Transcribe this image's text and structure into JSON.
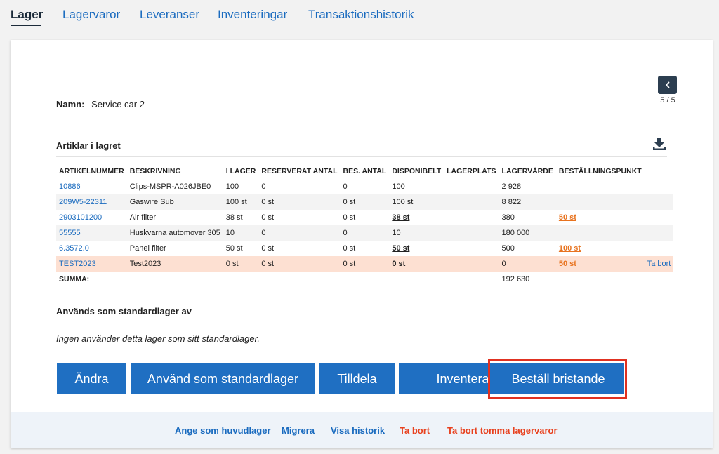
{
  "tabs": [
    "Lager",
    "Lagervaror",
    "Leveranser",
    "Inventeringar",
    "Transaktionshistorik"
  ],
  "name": {
    "label": "Namn:",
    "value": "Service car 2"
  },
  "pager": {
    "text": "5 / 5",
    "icon": "chevron-left-icon"
  },
  "articles": {
    "title": "Artiklar i lagret",
    "download_icon": "download-icon",
    "columns": [
      "Artikelnummer",
      "Beskrivning",
      "I lager",
      "Reserverat antal",
      "Bes. antal",
      "Disponibelt",
      "Lagerplats",
      "Lagervärde",
      "Beställningspunkt",
      ""
    ],
    "rows": [
      {
        "nr": "10886",
        "desc": "Clips-MSPR-A026JBE0",
        "stock": "100",
        "reserved": "0",
        "ordered": "0",
        "available": "100",
        "location": "",
        "value": "2 928",
        "reorder": "",
        "action": ""
      },
      {
        "nr": "209W5-22311",
        "desc": "Gaswire Sub",
        "stock": "100 st",
        "reserved": "0 st",
        "ordered": "0 st",
        "available": "100 st",
        "location": "",
        "value": "8 822",
        "reorder": "",
        "action": ""
      },
      {
        "nr": "2903101200",
        "desc": "Air filter",
        "stock": "38 st",
        "reserved": "0 st",
        "ordered": "0 st",
        "available": "38 st",
        "location": "",
        "value": "380",
        "reorder": "50 st",
        "action": ""
      },
      {
        "nr": "55555",
        "desc": "Huskvarna automover 305",
        "stock": "10",
        "reserved": "0",
        "ordered": "0",
        "available": "10",
        "location": "",
        "value": "180 000",
        "reorder": "",
        "action": ""
      },
      {
        "nr": "6.3572.0",
        "desc": "Panel filter",
        "stock": "50 st",
        "reserved": "0 st",
        "ordered": "0 st",
        "available": "50 st",
        "location": "",
        "value": "500",
        "reorder": "100 st",
        "action": ""
      },
      {
        "nr": "TEST2023",
        "desc": "Test2023",
        "stock": "0 st",
        "reserved": "0 st",
        "ordered": "0 st",
        "available": "0 st",
        "location": "",
        "value": "0",
        "reorder": "50 st",
        "action": "Ta bort"
      }
    ],
    "sum_label": "SUMMA:",
    "sum_value": "192 630"
  },
  "default_usage": {
    "title": "Används som standardlager av",
    "empty_text": "Ingen använder detta lager som sitt standardlager."
  },
  "buttons": [
    "Ändra",
    "Använd som standardlager",
    "Tilldela",
    "Inventera",
    "Beställ bristande"
  ],
  "footer_links": [
    "Ange som huvudlager",
    "Migrera",
    "Visa historik",
    "Ta bort",
    "Ta bort tomma lagervaror"
  ],
  "colors": {
    "primary": "#1f6fc2",
    "link": "#1a6bbf",
    "danger": "#e8401d",
    "warning_row": "#fde0d2",
    "highlight": "#e03121"
  }
}
